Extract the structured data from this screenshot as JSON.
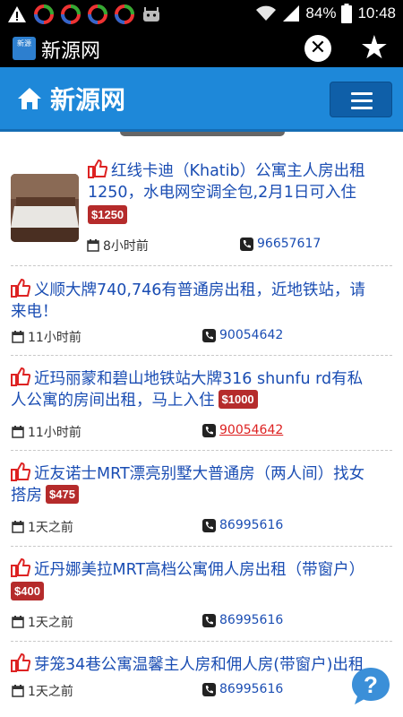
{
  "status_bar": {
    "battery": "84%",
    "time": "10:48"
  },
  "app_bar": {
    "logo_text": "新源",
    "title": "新源网"
  },
  "site_header": {
    "title": "新源网"
  },
  "listings": [
    {
      "title_line1": "红线卡迪（Khatib）公寓主人房出租",
      "title_line2": "1250，水电网空调全包,2月1日可入住",
      "price": "$1250",
      "time": "8小时前",
      "phone": "96657617"
    },
    {
      "title_line1": "义顺大牌740,746有普通房出租，近地铁站，请",
      "title_line2": "来电！",
      "price": "",
      "time": "11小时前",
      "phone": "90054642"
    },
    {
      "title_line1": "近玛丽蒙和碧山地铁站大牌316 shunfu rd有私",
      "title_line2": "人公寓的房间出租，马上入住",
      "price": "$1000",
      "time": "11小时前",
      "phone": "90054642"
    },
    {
      "title_line1": "近友诺士MRT漂亮别墅大普通房（两人间）找女",
      "title_line2": "搭房",
      "price": "$475",
      "time": "1天之前",
      "phone": "86995616"
    },
    {
      "title_line1": "近丹娜美拉MRT高档公寓佣人房出租（带窗户）",
      "title_line2": "",
      "price": "$400",
      "time": "1天之前",
      "phone": "86995616"
    },
    {
      "title_line1": "芽笼34巷公寓温馨主人房和佣人房(带窗户)出租",
      "title_line2": "",
      "price": "",
      "time": "1天之前",
      "phone": "86995616"
    }
  ],
  "icons": {
    "like": "thumbs-up-icon",
    "calendar": "calendar-icon",
    "phone": "phone-icon",
    "help": "help-question-icon"
  },
  "colors": {
    "header_blue": "#1e88d9",
    "link_blue": "#1a4db3",
    "price_red": "#b52b2b"
  }
}
